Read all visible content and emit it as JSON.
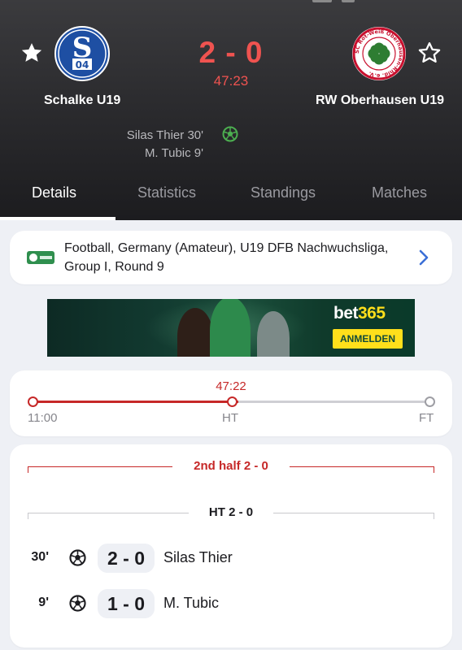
{
  "match": {
    "home_team": "Schalke U19",
    "away_team": "RW Oberhausen U19",
    "score": "2 - 0",
    "clock": "47:23",
    "scorers": [
      "Silas Thier 30'",
      "M. Tubic 9'"
    ],
    "home_crest_text": "S04",
    "away_crest_text": "SC Rot-Weiß Oberhausen-Rhld. e.V."
  },
  "tabs": [
    {
      "label": "Details",
      "active": true
    },
    {
      "label": "Statistics",
      "active": false
    },
    {
      "label": "Standings",
      "active": false
    },
    {
      "label": "Matches",
      "active": false
    }
  ],
  "competition": {
    "text": "Football, Germany (Amateur), U19 DFB Nachwuchsliga, Group I, Round 9"
  },
  "ad": {
    "brand_main": "bet",
    "brand_accent": "365",
    "cta": "ANMELDEN"
  },
  "timeline": {
    "current_time": "47:22",
    "progress_fraction": 0.52,
    "labels": [
      "11:00",
      "HT",
      "FT"
    ]
  },
  "events": {
    "second_half_label": "2nd half 2 - 0",
    "ht_label": "HT 2 - 0",
    "rows": [
      {
        "minute": "30'",
        "score": "2 - 0",
        "player": "Silas Thier"
      },
      {
        "minute": "9'",
        "score": "1 - 0",
        "player": "M. Tubic"
      }
    ]
  },
  "colors": {
    "accent_red": "#ef5350",
    "timeline_red": "#c62828",
    "goal_green": "#4caf50",
    "schalke_blue": "#1e4fa3",
    "rwo_red": "#c8102e",
    "rwo_green": "#2e7d32"
  },
  "icons": {
    "favorite": "star-outline-icon",
    "goal": "soccer-ball-icon",
    "navigate": "chevron-right-icon"
  }
}
